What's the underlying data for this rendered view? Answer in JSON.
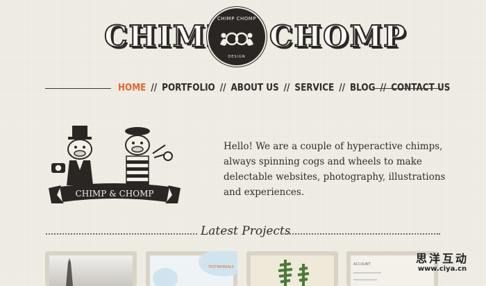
{
  "header": {
    "brand_left": "CHIMP",
    "brand_right": "CHOMP",
    "logo": {
      "top_text": "CHIMP CHOMP",
      "bottom_text": "DESIGN"
    }
  },
  "nav": {
    "items": [
      {
        "label": "HOME",
        "active": true
      },
      {
        "label": "PORTFOLIO",
        "active": false
      },
      {
        "label": "ABOUT US",
        "active": false
      },
      {
        "label": "SERVICE",
        "active": false
      },
      {
        "label": "BLOG",
        "active": false
      },
      {
        "label": "CONTACT US",
        "active": false
      }
    ],
    "separator": "//",
    "active_color": "#e4672f"
  },
  "mascot": {
    "banner_text": "CHIMP & CHOMP",
    "icon": "two-chimps-illustration"
  },
  "intro": {
    "text": "Hello! We are a couple of hyperactive chimps, always spinning cogs and wheels to make delectable websites, photography, illustrations and experiences."
  },
  "projects": {
    "title": "Latest Projects",
    "thumbs": [
      {
        "icon": "tower-photo"
      },
      {
        "icon": "testimonials-webpage",
        "text": "TESTIMONIALS"
      },
      {
        "icon": "plants-photo"
      },
      {
        "icon": "account-webpage",
        "text": "ACCOUNT"
      }
    ]
  },
  "watermark": {
    "main": "思洋互动",
    "url": "www.ciya.cn"
  }
}
